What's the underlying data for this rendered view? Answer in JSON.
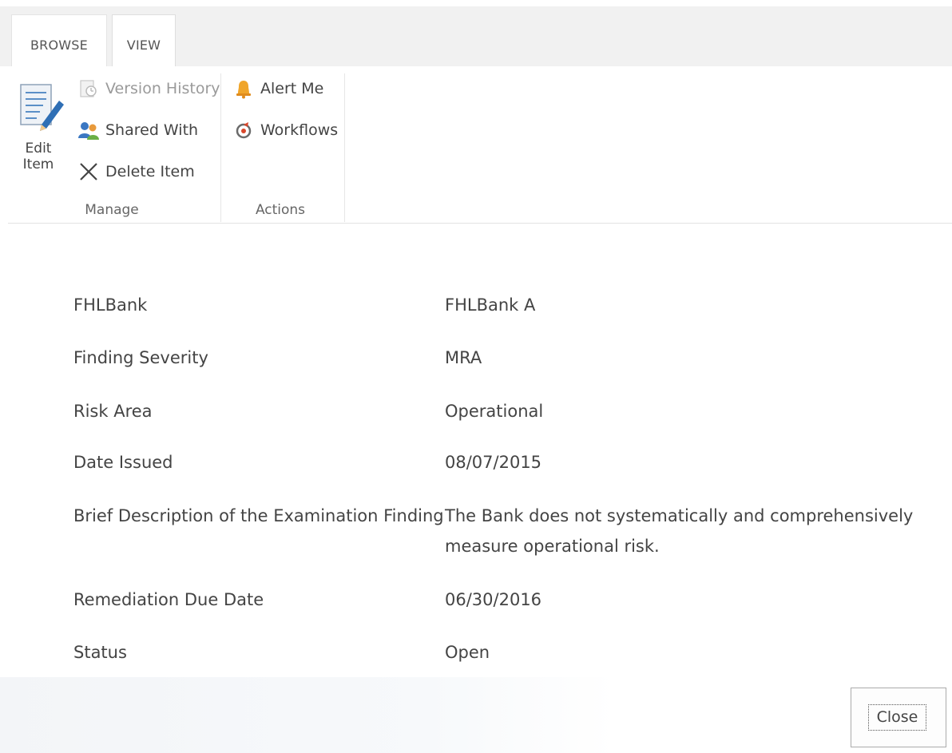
{
  "tabs": [
    {
      "label": "BROWSE"
    },
    {
      "label": "VIEW"
    }
  ],
  "ribbon": {
    "edit_item": {
      "label": "Edit Item",
      "icon": "edit-item-icon"
    },
    "manage": {
      "label": "Manage",
      "version_history": {
        "label": "Version History",
        "icon": "version-history-icon",
        "state": "disabled"
      },
      "shared_with": {
        "label": "Shared With",
        "icon": "shared-with-icon"
      },
      "delete_item": {
        "label": "Delete Item",
        "icon": "delete-x-icon"
      }
    },
    "actions": {
      "label": "Actions",
      "alert_me": {
        "label": "Alert Me",
        "icon": "bell-icon"
      },
      "workflows": {
        "label": "Workflows",
        "icon": "workflows-icon"
      }
    }
  },
  "fields": [
    {
      "label": "FHLBank",
      "value": "FHLBank A"
    },
    {
      "label": "Finding Severity",
      "value": "MRA"
    },
    {
      "label": "Risk Area",
      "value": "Operational"
    },
    {
      "label": "Date Issued",
      "value": "08/07/2015"
    },
    {
      "label": "Brief Description of the Examination Finding",
      "value": "The Bank does not systematically and comprehensively measure operational risk."
    },
    {
      "label": "Remediation Due Date",
      "value": "06/30/2016"
    },
    {
      "label": "Status",
      "value": "Open"
    }
  ],
  "footer": {
    "close_label": "Close"
  },
  "colors": {
    "ribbon_background": "#f1f1f1",
    "bell_accent": "#f0a52a",
    "text": "#444444"
  }
}
